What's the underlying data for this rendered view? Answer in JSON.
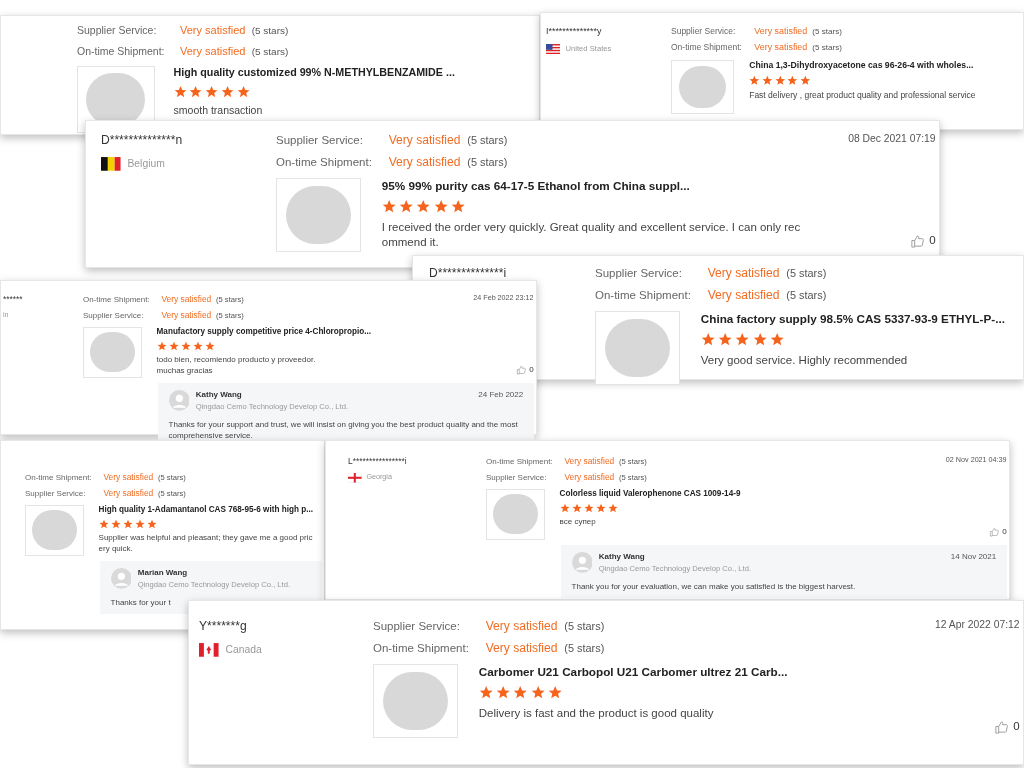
{
  "reviews": [
    {
      "ratings": [
        {
          "label": "Supplier Service:",
          "value": "Very satisfied",
          "note": "(5 stars)"
        },
        {
          "label": "On-time Shipment:",
          "value": "Very satisfied",
          "note": "(5 stars)"
        }
      ],
      "product": {
        "title": "High quality customized 99% N-METHYLBENZAMIDE ...",
        "stars": 5,
        "review_lines": [
          "smooth transaction"
        ]
      }
    },
    {
      "user": "I**************y",
      "country": "United States",
      "flag": {
        "kind": "us"
      },
      "ratings": [
        {
          "label": "Supplier Service:",
          "value": "Very satisfied",
          "note": "(5 stars)"
        },
        {
          "label": "On-time Shipment:",
          "value": "Very satisfied",
          "note": "(5 stars)"
        }
      ],
      "product": {
        "title": "China 1,3-Dihydroxyacetone cas 96-26-4 with wholes...",
        "stars": 5,
        "review_lines": [
          "Fast delivery , great product quality and professional service"
        ]
      }
    },
    {
      "user": "D**************n",
      "country": "Belgium",
      "flag": {
        "kind": "belgium"
      },
      "date": "08 Dec 2021 07:19",
      "ratings": [
        {
          "label": "Supplier Service:",
          "value": "Very satisfied",
          "note": "(5 stars)"
        },
        {
          "label": "On-time Shipment:",
          "value": "Very satisfied",
          "note": "(5 stars)"
        }
      ],
      "product": {
        "title": "95% 99% purity cas 64-17-5 Ethanol from China suppl...",
        "stars": 5,
        "review_lines": [
          "I received the order very quickly. Great quality and excellent service. I can only rec",
          "ommend it."
        ]
      },
      "likes": "0"
    },
    {
      "user": "D**************i",
      "ratings": [
        {
          "label": "Supplier Service:",
          "value": "Very satisfied",
          "note": "(5 stars)"
        },
        {
          "label": "On-time Shipment:",
          "value": "Very satisfied",
          "note": "(5 stars)"
        }
      ],
      "product": {
        "title": "China factory supply 98.5% CAS 5337-93-9 ETHYL-P-...",
        "stars": 5,
        "review_lines": [
          "Very good service. Highly recommended"
        ]
      }
    },
    {
      "user": "******",
      "country": "in",
      "date": "24 Feb 2022 23:12",
      "ratings": [
        {
          "label": "On-time Shipment:",
          "value": "Very satisfied",
          "note": "(5 stars)"
        },
        {
          "label": "Supplier Service:",
          "value": "Very satisfied",
          "note": "(5 stars)"
        }
      ],
      "product": {
        "title": "Manufactory supply competitive price 4-Chloropropio...",
        "stars": 5,
        "review_lines": [
          "todo bien, recomiendo producto y proveedor.",
          "muchas gracias"
        ]
      },
      "likes": "0",
      "reply": {
        "name": "Kathy Wang",
        "company": "Qingdao Cemo Technology Develop Co., Ltd.",
        "date": "24 Feb 2022",
        "text": "Thanks for your support and trust, we will insist on giving you the best product quality and the most comprehensive service."
      }
    },
    {
      "ratings": [
        {
          "label": "On-time Shipment:",
          "value": "Very satisfied",
          "note": "(5 stars)"
        },
        {
          "label": "Supplier Service:",
          "value": "Very satisfied",
          "note": "(5 stars)"
        }
      ],
      "product": {
        "title": "High quality 1-Adamantanol CAS 768-95-6 with high p...",
        "stars": 5,
        "review_lines": [
          "Supplier was helpful and pleasant; they gave me a good pric",
          "ery quick."
        ]
      },
      "reply": {
        "name": "Marian Wang",
        "company": "Qingdao Cemo Technology Develop Co., Ltd.",
        "text": "Thanks for your t"
      }
    },
    {
      "user": "L****************i",
      "country": "Georgia",
      "flag": {
        "kind": "georgia"
      },
      "date": "02 Nov 2021 04:39",
      "ratings": [
        {
          "label": "On-time Shipment:",
          "value": "Very satisfied",
          "note": "(5 stars)"
        },
        {
          "label": "Supplier Service:",
          "value": "Very satisfied",
          "note": "(5 stars)"
        }
      ],
      "product": {
        "title": "Colorless liquid Valerophenone CAS 1009-14-9",
        "stars": 5,
        "review_lines": [
          "все супер"
        ]
      },
      "likes": "0",
      "reply": {
        "name": "Kathy Wang",
        "company": "Qingdao Cemo Technology Develop Co., Ltd.",
        "date": "14 Nov 2021",
        "text": "Thank you for your evaluation, we can make you satisfied is the biggest harvest."
      }
    },
    {
      "user": "Y*******g",
      "country": "Canada",
      "flag": {
        "kind": "canada"
      },
      "date": "12 Apr 2022 07:12",
      "ratings": [
        {
          "label": "Supplier Service:",
          "value": "Very satisfied",
          "note": "(5 stars)"
        },
        {
          "label": "On-time Shipment:",
          "value": "Very satisfied",
          "note": "(5 stars)"
        }
      ],
      "product": {
        "title": "Carbomer U21 Carbopol U21 Carbomer ultrez 21 Carb...",
        "stars": 5,
        "review_lines": [
          "Delivery is fast and the product is good quality"
        ]
      },
      "likes": "0"
    }
  ]
}
